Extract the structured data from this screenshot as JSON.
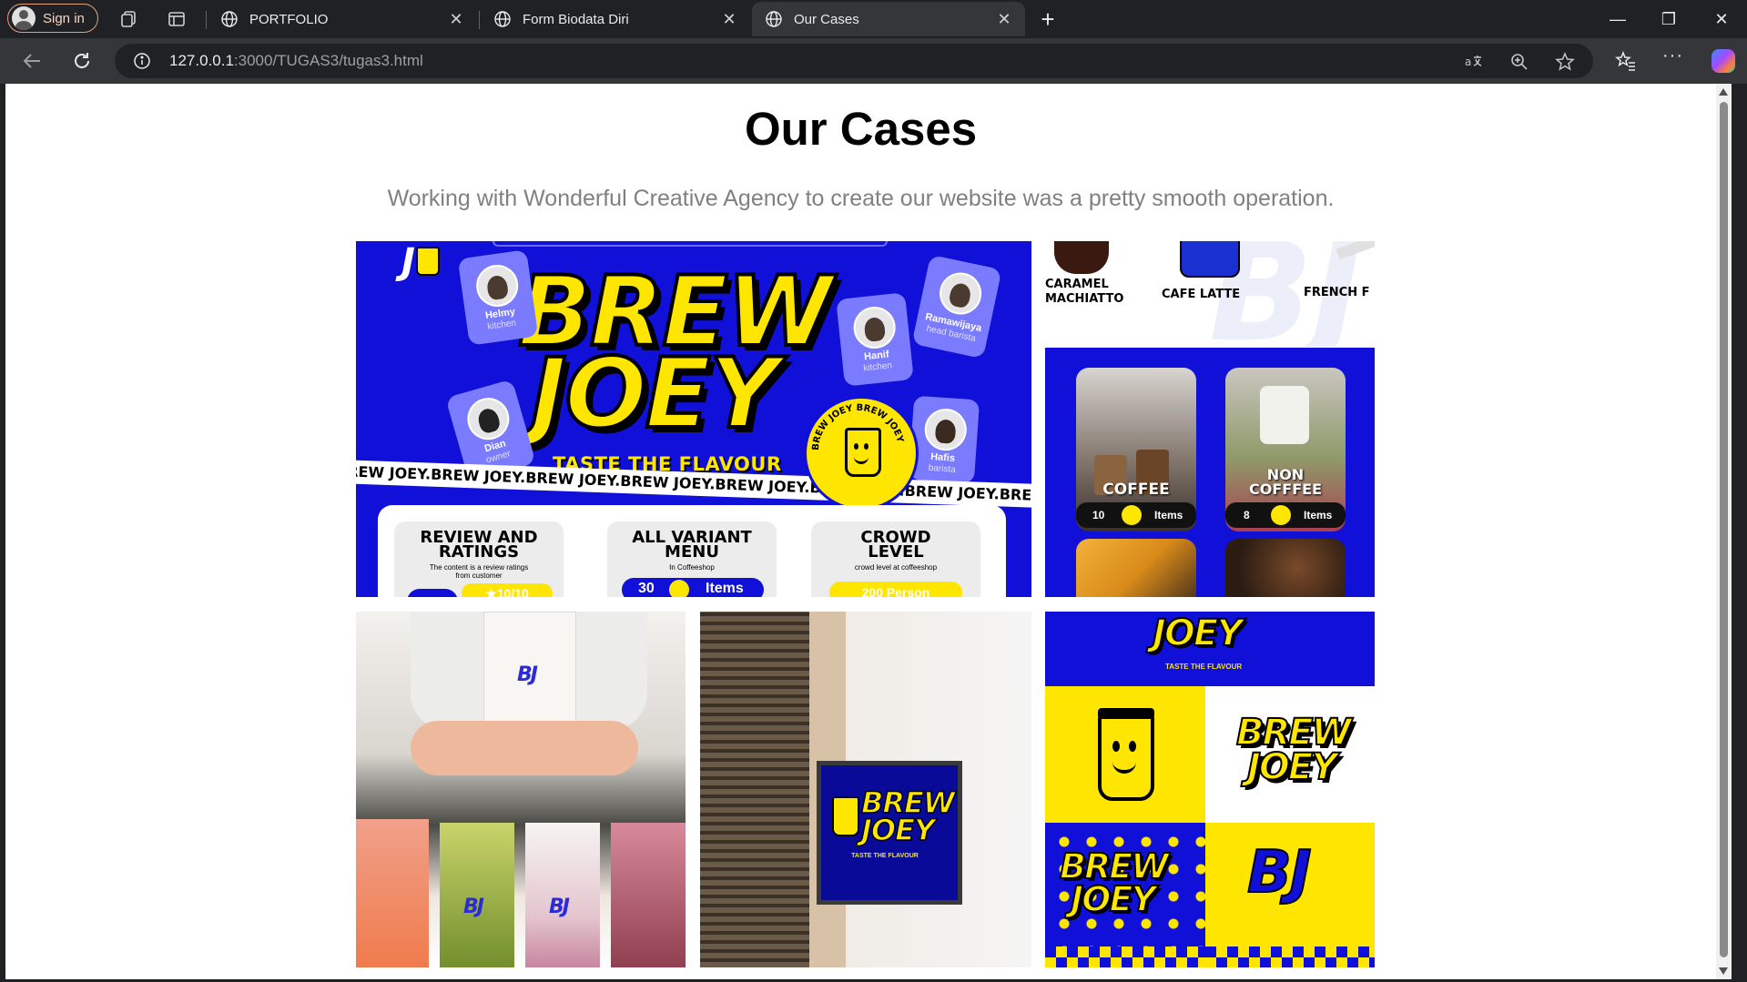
{
  "browser": {
    "sign_in_label": "Sign in",
    "tabs": [
      {
        "label": "PORTFOLIO",
        "active": false
      },
      {
        "label": "Form Biodata Diri",
        "active": false
      },
      {
        "label": "Our Cases",
        "active": true
      }
    ],
    "url_host": "127.0.0.1",
    "url_rest": ":3000/TUGAS3/tugas3.html"
  },
  "page": {
    "title": "Our Cases",
    "subtitle": "Working with Wonderful Creative Agency to create our website was a pretty smooth operation."
  },
  "cases": {
    "card1": {
      "brand_line1": "BREW",
      "brand_line2": "JOEY",
      "tagline": "TASTE THE FLAVOUR",
      "marquee": "REW JOEY.BREW JOEY.BREW JOEY.BREW JOEY.BREW JOEY.BREW JOEY.BREW JOEY.BREW JOE",
      "staff": [
        {
          "name": "Helmy",
          "role": "kitchen"
        },
        {
          "name": "Hanif",
          "role": "kitchen"
        },
        {
          "name": "Ramawijaya",
          "role": "head barista"
        },
        {
          "name": "Dian",
          "role": "owner"
        },
        {
          "name": "Hafis",
          "role": "barista"
        }
      ],
      "seal_text": "BREW JOEY BREW JOEY",
      "features": [
        {
          "title": "REVIEW AND RATINGS",
          "desc": "The content is a review ratings from customer",
          "pill": "★10/10"
        },
        {
          "title": "ALL VARIANT MENU",
          "desc": "In Coffeeshop",
          "pill_num": "30",
          "pill": "Items"
        },
        {
          "title": "CROWD LEVEL",
          "desc": "crowd level at coffeeshop",
          "pill": "200 Person"
        }
      ]
    },
    "card2": {
      "menu": [
        "CARAMEL MACHIATTO",
        "CAFE LATTE",
        "FRENCH F"
      ]
    },
    "card3": {
      "categories": [
        {
          "name": "COFFEE",
          "count": "10",
          "unit": "Items"
        },
        {
          "name": "NON COFFFEE",
          "count": "8",
          "unit": "Items"
        }
      ]
    },
    "card5": {
      "sign_line1": "BREW",
      "sign_line2": "JOEY",
      "sign_tagline": "TASTE THE FLAVOUR"
    },
    "card6": {
      "top_brand": "JOEY",
      "top_tagline": "TASTE THE FLAVOUR",
      "logo_line1": "BREW",
      "logo_line2": "JOEY",
      "pattern_line1": "BREW",
      "pattern_line2": "JOEY",
      "monogram": "BJ"
    }
  },
  "colors": {
    "brand_blue": "#1010d8",
    "brand_yellow": "#ffe600",
    "chrome_dark": "#202124",
    "chrome_toolbar": "#35363a"
  }
}
